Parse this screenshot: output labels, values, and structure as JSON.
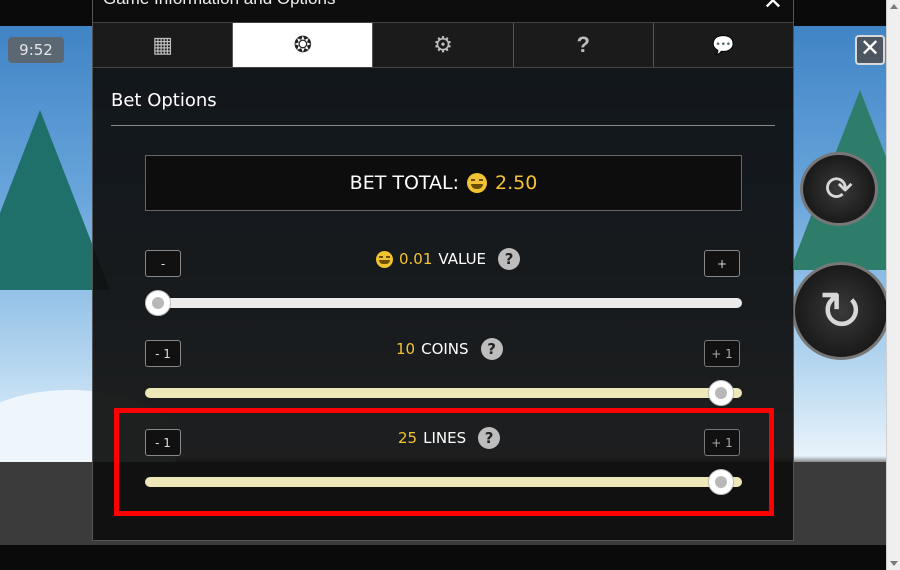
{
  "background": {
    "clock": "9:52",
    "close_symbol": "✕"
  },
  "modal": {
    "title": "Game Information and Options",
    "close_symbol": "✕",
    "tabs": [
      {
        "icon": "paytable-icon",
        "glyph": "▦",
        "active": false
      },
      {
        "icon": "coin-bet-icon",
        "glyph": "❂",
        "active": true
      },
      {
        "icon": "gear-icon",
        "glyph": "⚙",
        "active": false
      },
      {
        "icon": "help-icon",
        "glyph": "?",
        "active": false
      },
      {
        "icon": "chat-icon",
        "glyph": "💬",
        "active": false
      }
    ],
    "section_title": "Bet Options",
    "bet_total": {
      "label": "BET TOTAL:",
      "value": "2.50"
    },
    "value_row": {
      "number": "0.01",
      "label": "VALUE",
      "minus": "-",
      "plus": "+",
      "level": 0.0
    },
    "coins_row": {
      "number": "10",
      "label": "COINS",
      "minus": "- 1",
      "plus": "+ 1",
      "level": 1.0
    },
    "lines_row": {
      "number": "25",
      "label": "LINES",
      "minus": "- 1",
      "plus": "+ 1",
      "level": 1.0
    },
    "help_symbol": "?"
  },
  "colors": {
    "accent": "#f4c430",
    "highlight": "#ff0000",
    "active_tab": "#ffffff"
  }
}
